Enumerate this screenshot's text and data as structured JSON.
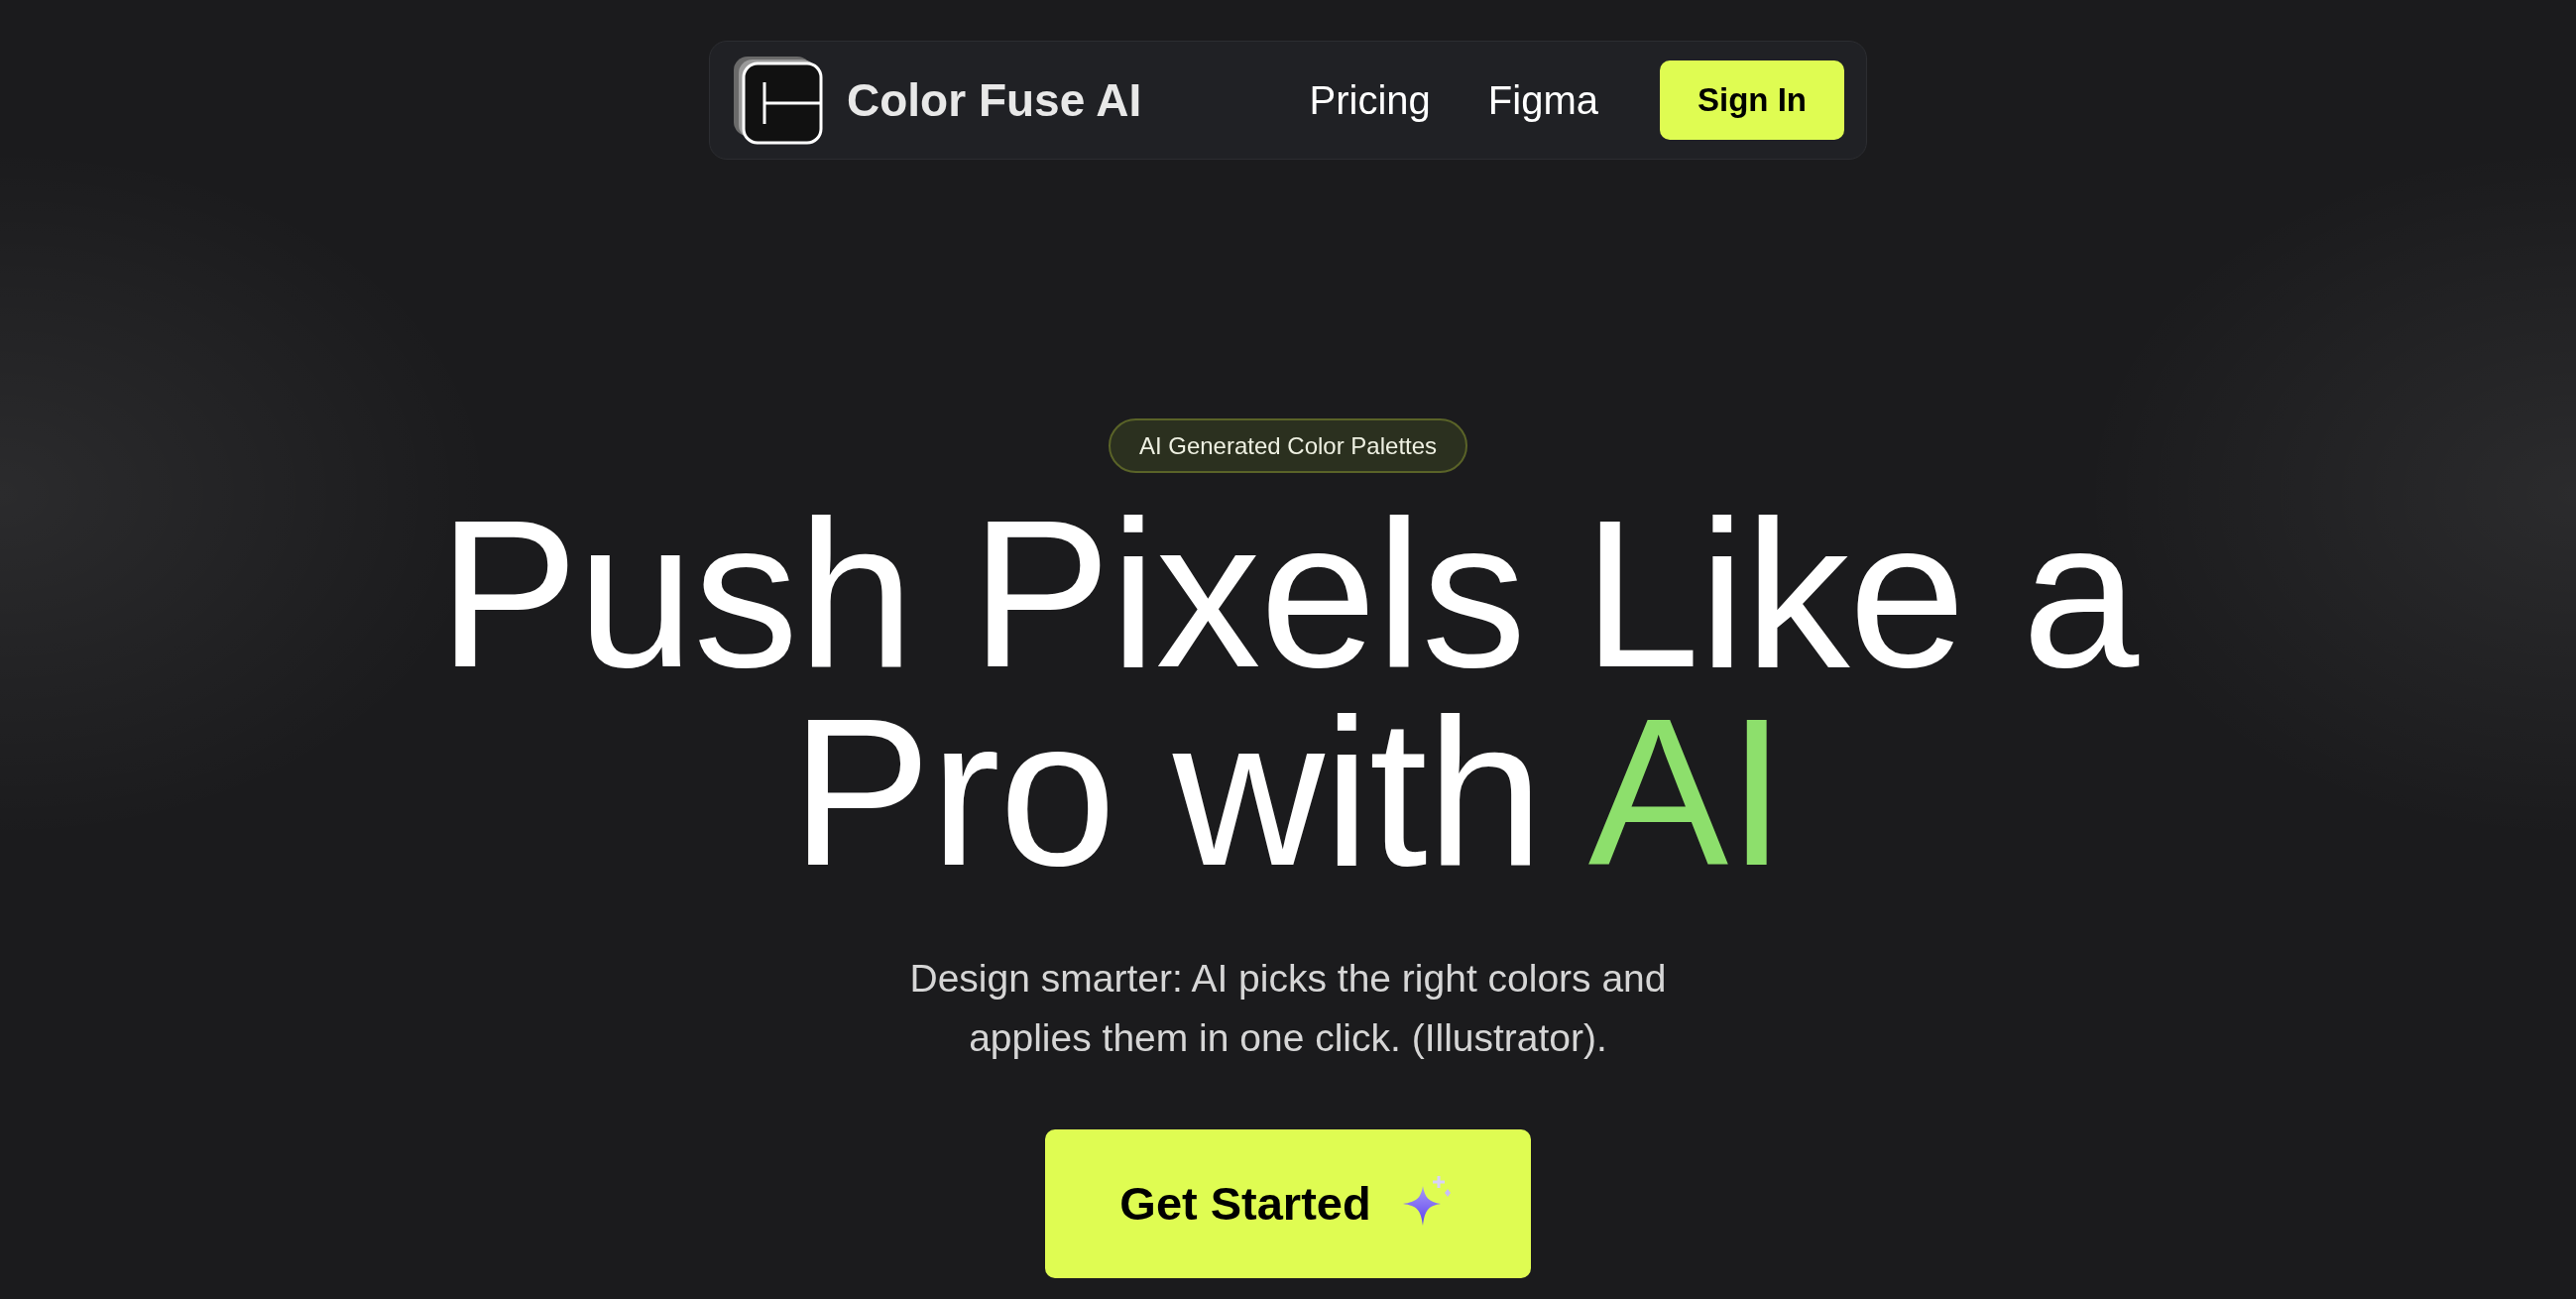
{
  "navbar": {
    "brand": "Color Fuse AI",
    "links": [
      "Pricing",
      "Figma"
    ],
    "sign_in": "Sign In"
  },
  "hero": {
    "badge": "AI Generated Color Palettes",
    "headline": [
      {
        "text": "Push Pixels Like a Pro with ",
        "highlight": false
      },
      {
        "text": "AI",
        "highlight": true
      }
    ],
    "subtitle": "Design smarter: AI picks the right colors and applies them in one click. (Illustrator).",
    "cta": "Get Started"
  }
}
